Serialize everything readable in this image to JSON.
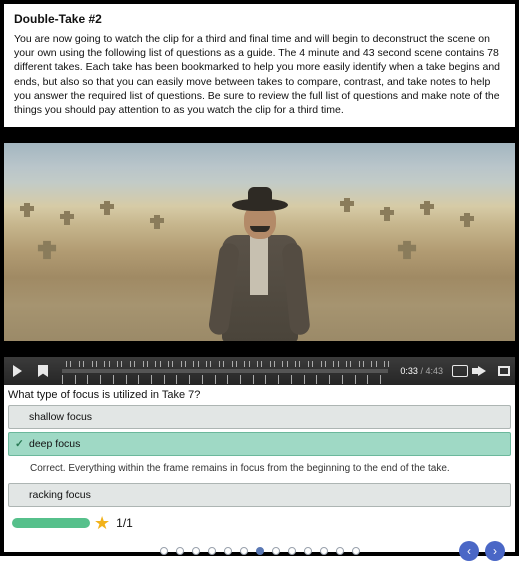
{
  "intro": {
    "title": "Double-Take #2",
    "body": "You are now going to watch the clip for a third and final time and will begin to deconstruct the scene on your own using the following list of questions as a guide. The 4 minute and 43 second scene contains 78 different takes. Each take has been bookmarked to help you more easily identify when a take begins and ends, but also so that you can easily move between takes to compare, contrast, and take notes to help you answer the required list of questions. Be sure to review the full list of questions and make note of the things you should pay attention to as you watch the clip for a third time."
  },
  "player": {
    "current_time": "0:33",
    "total_time": "4:43"
  },
  "quiz": {
    "question": "What type of focus is utilized in Take 7?",
    "options": [
      {
        "label": "shallow focus",
        "correct": false
      },
      {
        "label": "deep focus",
        "correct": true
      },
      {
        "label": "racking focus",
        "correct": false
      }
    ],
    "feedback": "Correct. Everything within the frame remains in focus from the beginning to the end of the take.",
    "score": "1/1"
  },
  "pager": {
    "total": 13,
    "active_index": 6
  }
}
